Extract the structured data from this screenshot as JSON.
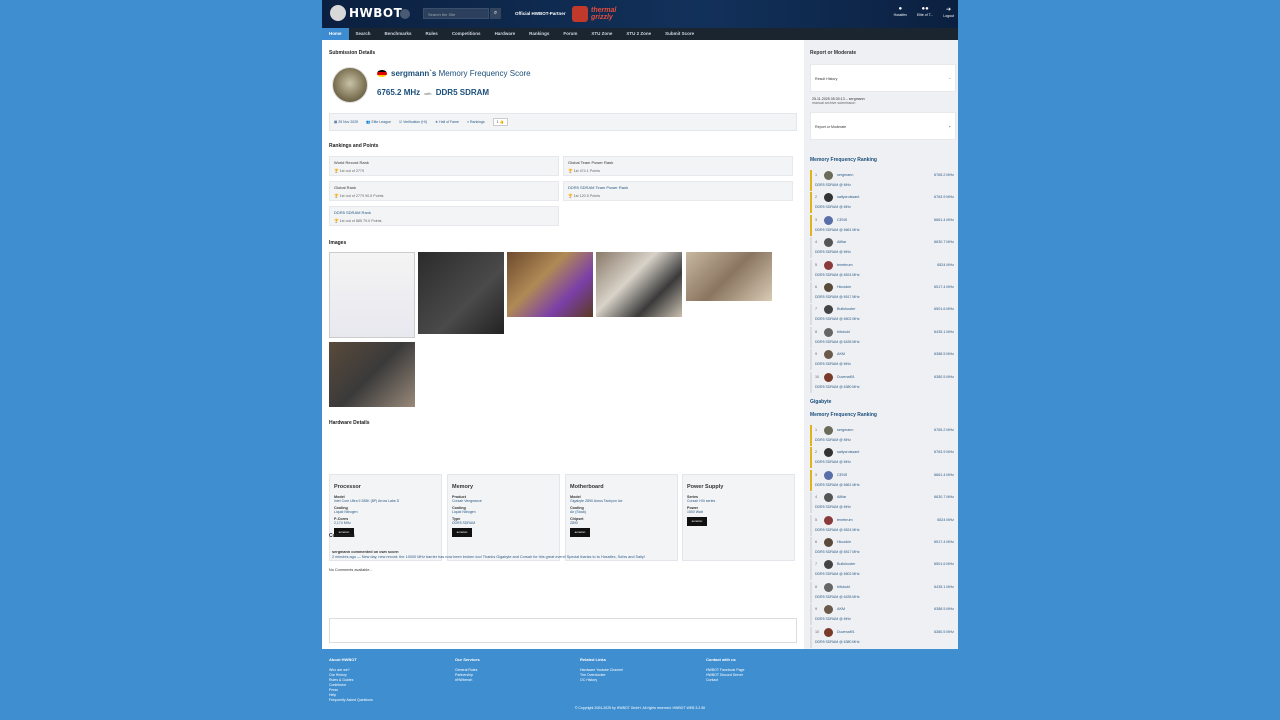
{
  "header": {
    "logo_text": "HWBOT",
    "search_placeholder": "Search the Site",
    "partner_label": "Official HWBOT-Partner",
    "partner_logo_line1": "thermal",
    "partner_logo_line2": "grizzly",
    "right_items": [
      {
        "icon": "user-icon",
        "label": "Hossifex"
      },
      {
        "icon": "users-icon",
        "label": "Elite of T..."
      },
      {
        "icon": "logout-icon",
        "label": "Logout"
      }
    ]
  },
  "nav": [
    "Home",
    "Search",
    "Benchmarks",
    "Rules",
    "Competitions",
    "Hardware",
    "Rankings",
    "Forum",
    "XTU Zone",
    "XTU 2 Zone",
    "Submit Score"
  ],
  "submission": {
    "section_title": "Submission Details",
    "user": "sergmann`s",
    "benchmark": "Memory Frequency Score",
    "score": "6765.2 MHz",
    "with": "with",
    "hardware": "DDR5 SDRAM",
    "info": {
      "date": "25 Nov 2025",
      "league": "Elite League",
      "verification": "Verification (HI)",
      "hall_of_fame": "Hall of Fame",
      "rankings": "Rankings",
      "likes": "1"
    }
  },
  "rankings": {
    "section_title": "Rankings and Points",
    "cards": [
      {
        "title": "World Record Rank",
        "value": "1st out of 2779"
      },
      {
        "title": "Global Team Power Rank",
        "value": "1st  474.1 Points"
      },
      {
        "title": "Global Rank",
        "value": "1st out of 2779   90.5 Points"
      },
      {
        "title": "DDR5 SDRAM  Team Power Rank",
        "value": "1st  120.5 Points"
      },
      {
        "title": "DDR5 SDRAM  Rank",
        "value": "1st out of 885   79.0 Points"
      }
    ]
  },
  "images": {
    "section_title": "Images"
  },
  "hardware": {
    "section_title": "Hardware Details",
    "cards": [
      {
        "title": "Processor",
        "rows": [
          {
            "k": "Model",
            "v": "Intel Core Ultra 9 285K (8P) Arrow Lake-S"
          },
          {
            "k": "Cooling",
            "v": "Liquid Nitrogen"
          },
          {
            "k": "P-Cores",
            "v": "2,174 MHz"
          }
        ]
      },
      {
        "title": "Memory",
        "rows": [
          {
            "k": "Product",
            "v": "Corsair Vengeance"
          },
          {
            "k": "Cooling",
            "v": "Liquid Nitrogen"
          },
          {
            "k": "Type",
            "v": "DDR5 SDRAM"
          }
        ]
      },
      {
        "title": "Motherboard",
        "rows": [
          {
            "k": "Model",
            "v": "Gigabyte Z890 Aorus Tachyon Ice"
          },
          {
            "k": "Cooling",
            "v": "Air (Stock)"
          },
          {
            "k": "Chipset",
            "v": "Z890"
          }
        ]
      },
      {
        "title": "Power Supply",
        "rows": [
          {
            "k": "Series",
            "v": "Corsair HXi series"
          },
          {
            "k": "Power",
            "v": "1500 Watt"
          }
        ]
      }
    ],
    "amazon_label": "amazon"
  },
  "comments": {
    "section_title": "Comments",
    "author_line": "sergmann commented on own score:",
    "comment_text": "2 minutes ago — New day, new record: the 10000 MHz barrier has now been broken too! Thanks Gigabyte and Corsair for this great event! Special thanks to to Hossifex, Sofxs and Saliy!",
    "no_comments": "No Comments available...",
    "save_label": "Save"
  },
  "sidebar": {
    "report_title": "Report or Moderate",
    "result_history": "Result History",
    "history_date": "25.11.2025 05:30:13  – sergmann",
    "history_note": "manual archive submission",
    "report_moderate": "Report or Moderate",
    "ranking1_title": "Memory Frequency Ranking",
    "group2_title": "Gigabyte",
    "ranking2_title": "Memory Frequency Ranking",
    "ranking1": [
      {
        "n": "1",
        "name": "sergmann",
        "score": "6765.2 MHz",
        "hw": "DDR5 SDRAM @ MHz"
      },
      {
        "n": "2",
        "name": "saltycroissant",
        "score": "6763.9 MHz",
        "hw": "DDR5 SDRAM @ MHz"
      },
      {
        "n": "3",
        "name": "CENS",
        "score": "6661.4 MHz",
        "hw": "DDR5 SDRAM @ 6661 MHz"
      },
      {
        "n": "4",
        "name": "Allfiar",
        "score": "6630.7 MHz",
        "hw": "DDR5 SDRAM @ MHz"
      },
      {
        "n": "5",
        "name": "tenebrum",
        "score": "6524 MHz",
        "hw": "DDR5 SDRAM @ 6524 MHz"
      },
      {
        "n": "6",
        "name": "Hicookie",
        "score": "6517.4 MHz",
        "hw": "DDR5 SDRAM @ 6517 MHz"
      },
      {
        "n": "7",
        "name": "Bullshooter",
        "score": "6501.6 MHz",
        "hw": "DDR5 SDRAM @ 6502 MHz"
      },
      {
        "n": "8",
        "name": "bifokoid",
        "score": "6435.1 MHz",
        "hw": "DDR5 SDRAM @ 6435 MHz"
      },
      {
        "n": "9",
        "name": "AKM",
        "score": "6388.5 MHz",
        "hw": "DDR5 SDRAM @ MHz"
      },
      {
        "n": "10",
        "name": "Duvenal91",
        "score": "6380.5 MHz",
        "hw": "DDR5 SDRAM @ 6380 MHz"
      }
    ],
    "ranking2": [
      {
        "n": "1",
        "name": "sergmann",
        "score": "6765.2 MHz",
        "hw": "DDR5 SDRAM @ MHz"
      },
      {
        "n": "2",
        "name": "saltycroissant",
        "score": "6763.9 MHz",
        "hw": "DDR5 SDRAM @ MHz"
      },
      {
        "n": "3",
        "name": "CENS",
        "score": "6661.4 MHz",
        "hw": "DDR5 SDRAM @ 6661 MHz"
      },
      {
        "n": "4",
        "name": "Allfiar",
        "score": "6630.7 MHz",
        "hw": "DDR5 SDRAM @ MHz"
      },
      {
        "n": "5",
        "name": "tenebrum",
        "score": "6524 MHz",
        "hw": "DDR5 SDRAM @ 6524 MHz"
      },
      {
        "n": "6",
        "name": "Hicookie",
        "score": "6517.4 MHz",
        "hw": "DDR5 SDRAM @ 6517 MHz"
      },
      {
        "n": "7",
        "name": "Bullshooter",
        "score": "6501.6 MHz",
        "hw": "DDR5 SDRAM @ 6502 MHz"
      },
      {
        "n": "8",
        "name": "bifokoid",
        "score": "6435.1 MHz",
        "hw": "DDR5 SDRAM @ 6435 MHz"
      },
      {
        "n": "9",
        "name": "AKM",
        "score": "6388.5 MHz",
        "hw": "DDR5 SDRAM @ MHz"
      },
      {
        "n": "10",
        "name": "Duvenal91",
        "score": "6380.5 MHz",
        "hw": "DDR5 SDRAM @ 6380 MHz"
      }
    ]
  },
  "footer": {
    "cols": [
      {
        "title": "About HWBOT",
        "links": [
          "Who are we?",
          "Our History",
          "Rules & Guides",
          "Contributor",
          "Press",
          "Help",
          "Frequently Asked Questions"
        ]
      },
      {
        "title": "Our Services",
        "links": [
          "General Rules",
          "Partnership",
          "#HWbench"
        ]
      },
      {
        "title": "Related Links",
        "links": [
          "Hardware Youtube Channel",
          "The Overclocker",
          "OC History"
        ]
      },
      {
        "title": "Contact with us",
        "links": [
          "HWBOT Facebook Page",
          "HWBOT Discord Server",
          "Contact"
        ]
      }
    ],
    "copyright": "© Copyright 2004-2025 by HWBOT GmbH. All rights reserved. HWBOT WEB 3.2.56"
  },
  "colors": {
    "accent": "#3f8fd0",
    "link": "#2c5a86",
    "gold": "#e2b21d",
    "header_bg": "#0b2040"
  }
}
